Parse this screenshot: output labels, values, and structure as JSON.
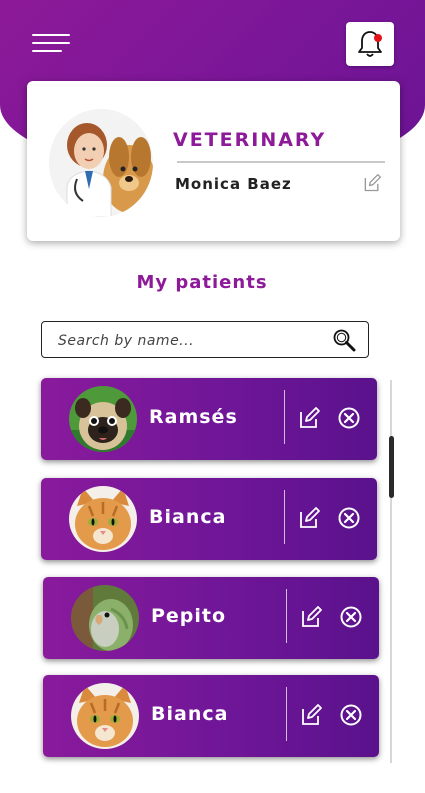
{
  "header": {
    "menu_icon": "hamburger-icon",
    "notification_icon": "bell-icon",
    "has_unread_notifications": true
  },
  "profile": {
    "role": "VETERINARY",
    "name": "Monica Baez",
    "edit_icon": "edit-icon"
  },
  "patients_section": {
    "title": "My patients",
    "search_placeholder": "Search by name...",
    "search_value": ""
  },
  "patients": [
    {
      "name": "Ramsés",
      "species": "dog"
    },
    {
      "name": "Bianca",
      "species": "cat"
    },
    {
      "name": "Pepito",
      "species": "bird"
    },
    {
      "name": "Bianca",
      "species": "cat"
    }
  ],
  "colors": {
    "brand_purple": "#8d1a98",
    "card_gradient_start": "#8a1a9c",
    "card_gradient_end": "#5a128c",
    "notification_dot": "#e3121a"
  }
}
